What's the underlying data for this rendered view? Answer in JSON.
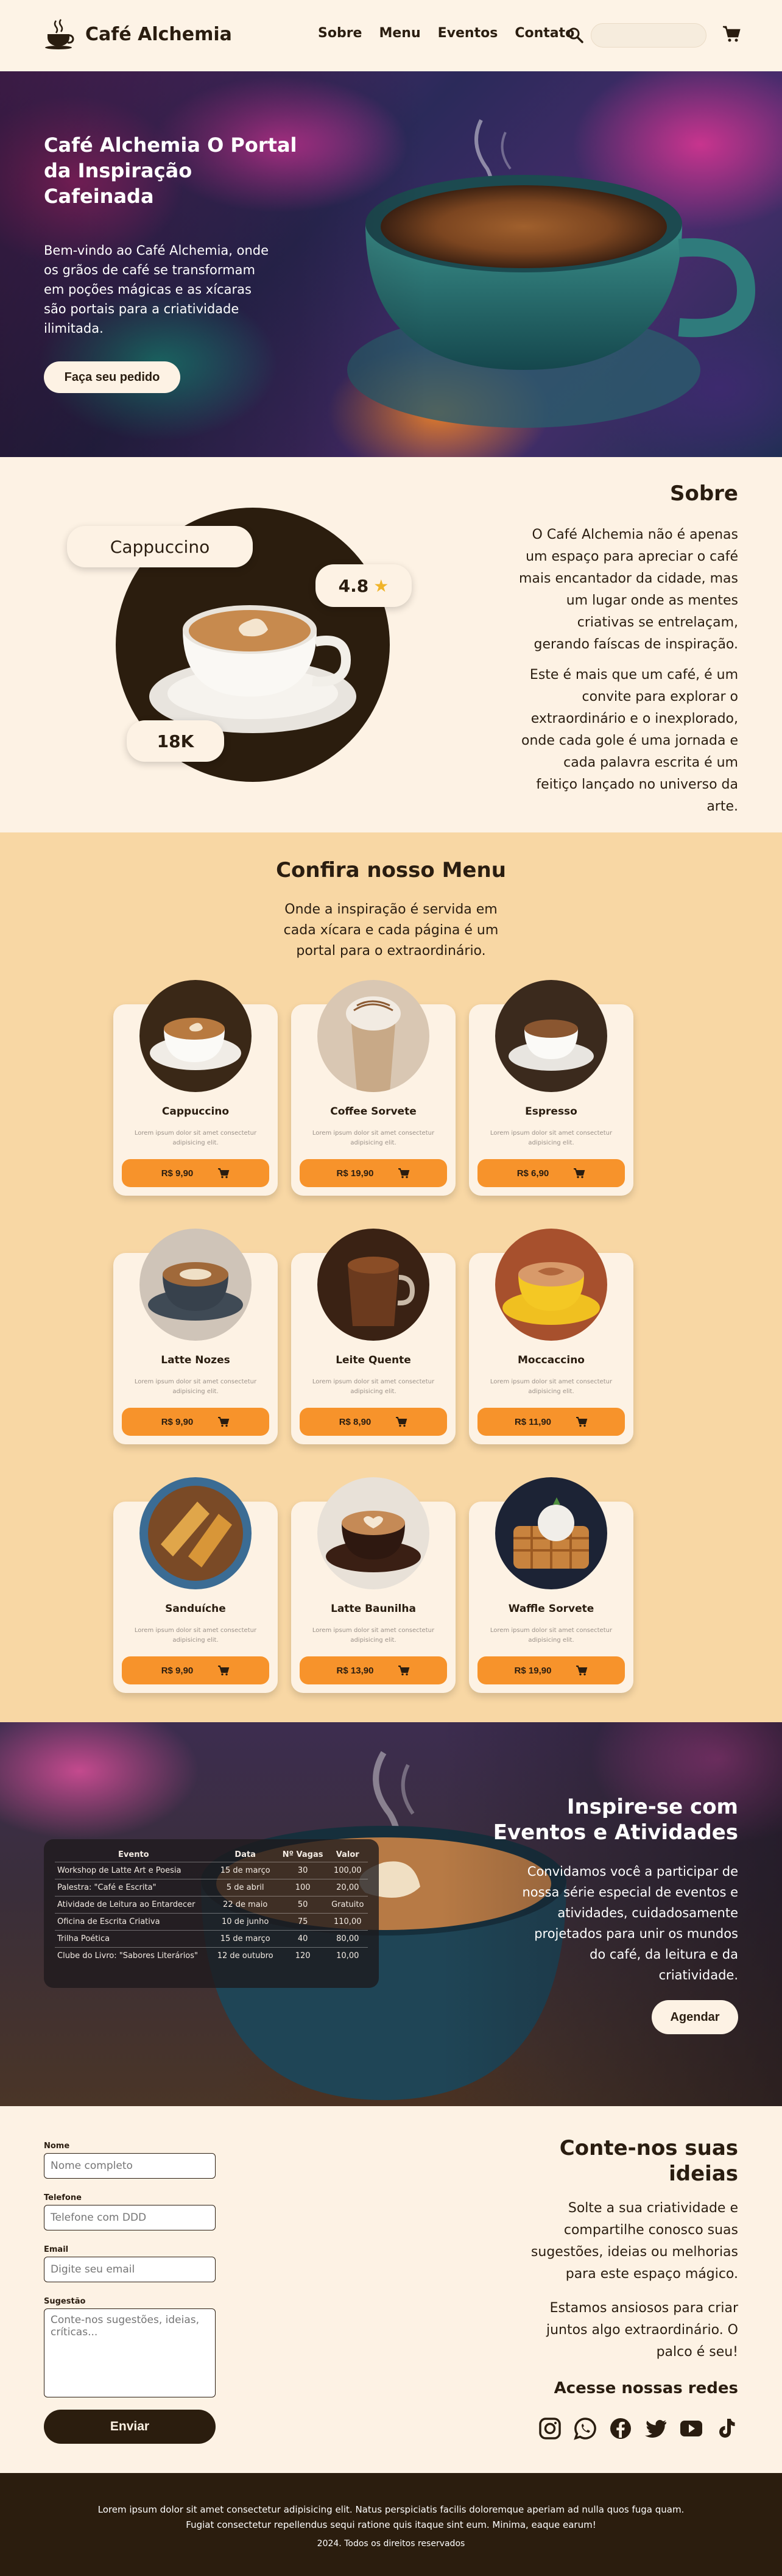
{
  "header": {
    "brand": "Café Alchemia",
    "nav": [
      "Sobre",
      "Menu",
      "Eventos",
      "Contato"
    ],
    "search_placeholder": ""
  },
  "hero": {
    "title": "Café Alchemia O Portal da Inspiração Cafeinada",
    "text": "Bem-vindo ao Café Alchemia, onde os grãos de café se transformam em poções mágicas e as xícaras são portais para a criatividade ilimitada.",
    "cta": "Faça seu pedido"
  },
  "sobre": {
    "title": "Sobre",
    "p1": "O Café Alchemia não é apenas um espaço para apreciar o café mais encantador da cidade, mas um lugar onde as mentes criativas se entrelaçam, gerando faíscas de inspiração.",
    "p2": "Este é mais que um café, é um convite para explorar o extraordinário e o inexplorado, onde cada gole é uma jornada e cada palavra escrita é um feitiço lançado no universo da arte.",
    "badge_name": "Cappuccino",
    "badge_rating": "4.8",
    "badge_count": "18K"
  },
  "menu": {
    "title": "Confira nosso Menu",
    "subtitle": "Onde a inspiração é servida em cada xícara e cada página é um portal para o extraordinário.",
    "desc": "Lorem ipsum dolor sit amet consectetur adipisicing elit.",
    "items": [
      {
        "name": "Cappuccino",
        "price": "R$ 9,90"
      },
      {
        "name": "Coffee Sorvete",
        "price": "R$ 19,90"
      },
      {
        "name": "Espresso",
        "price": "R$ 6,90"
      },
      {
        "name": "Latte Nozes",
        "price": "R$ 9,90"
      },
      {
        "name": "Leite Quente",
        "price": "R$ 8,90"
      },
      {
        "name": "Moccaccino",
        "price": "R$ 11,90"
      },
      {
        "name": "Sanduíche",
        "price": "R$ 9,90"
      },
      {
        "name": "Latte Baunilha",
        "price": "R$ 13,90"
      },
      {
        "name": "Waffle Sorvete",
        "price": "R$ 19,90"
      }
    ]
  },
  "eventos": {
    "title": "Inspire-se com Eventos e Atividades",
    "text": "Convidamos você a participar de nossa série especial de eventos e atividades, cuidadosamente projetados para unir os mundos do café, da leitura e da criatividade.",
    "cta": "Agendar",
    "columns": [
      "Evento",
      "Data",
      "Nº Vagas",
      "Valor"
    ],
    "rows": [
      [
        "Workshop de Latte Art e Poesia",
        "15 de março",
        "30",
        "100,00"
      ],
      [
        "Palestra: \"Café e Escrita\"",
        "5 de abril",
        "100",
        "20,00"
      ],
      [
        "Atividade de Leitura ao Entardecer",
        "22 de maio",
        "50",
        "Gratuito"
      ],
      [
        "Oficina de Escrita Criativa",
        "10 de junho",
        "75",
        "110,00"
      ],
      [
        "Trilha Poética",
        "15 de março",
        "40",
        "80,00"
      ],
      [
        "Clube do Livro: \"Sabores Literários\"",
        "12 de outubro",
        "120",
        "10,00"
      ]
    ]
  },
  "contato": {
    "labels": {
      "nome": "Nome",
      "telefone": "Telefone",
      "email": "Email",
      "sugestao": "Sugestão"
    },
    "placeholders": {
      "nome": "Nome completo",
      "telefone": "Telefone com DDD",
      "email": "Digite seu email",
      "sugestao": "Conte-nos sugestões, ideias, críticas..."
    },
    "submit": "Enviar",
    "title": "Conte-nos suas ideias",
    "p1": "Solte a sua criatividade e compartilhe conosco suas sugestões, ideias ou melhorias para este espaço mágico.",
    "p2": "Estamos ansiosos para criar juntos algo extraordinário. O palco é seu!",
    "redes_title": "Acesse nossas redes",
    "social_icons": [
      "instagram-icon",
      "whatsapp-icon",
      "facebook-icon",
      "twitter-icon",
      "youtube-icon",
      "tiktok-icon"
    ]
  },
  "footer": {
    "text": "Lorem ipsum dolor sit amet consectetur adipisicing elit. Natus perspiciatis facilis doloremque aperiam ad nulla quos fuga quam. Fugiat consectetur repellendus sequi ratione quis itaque sint eum. Minima, eaque earum!",
    "copy": "2024. Todos os direitos reservados"
  },
  "colors": {
    "dark": "#2b1d0e",
    "cream": "#fdf2e4",
    "peach": "#f8d7a4",
    "orange": "#f7932b"
  }
}
